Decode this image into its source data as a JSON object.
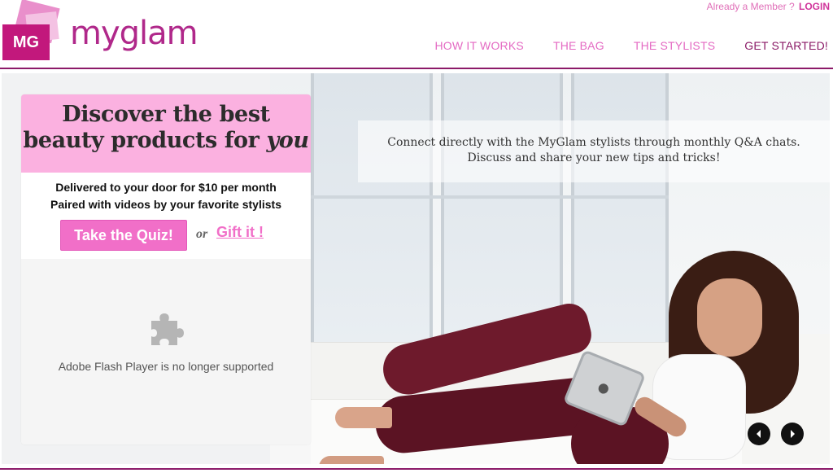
{
  "header": {
    "member_prompt": "Already a Member ?",
    "login_label": "LOGIN",
    "logo_mark": "MG",
    "logo_word": "myglam",
    "nav": [
      {
        "label": "HOW IT WORKS"
      },
      {
        "label": "THE BAG"
      },
      {
        "label": "THE STYLISTS"
      },
      {
        "label": "GET STARTED!"
      }
    ]
  },
  "promo": {
    "headline_line1": "Discover the best",
    "headline_line2_prefix": "beauty products for ",
    "headline_line2_em": "you",
    "subline1": "Delivered to your door for $10 per month",
    "subline2": "Paired with videos by your favorite stylists",
    "quiz_button": "Take the Quiz!",
    "or_text": "or",
    "gift_link": "Gift it !"
  },
  "flash": {
    "message": "Adobe Flash Player is no longer supported",
    "icon": "puzzle-piece-icon"
  },
  "hero": {
    "info_line1": "Connect directly with the MyGlam stylists through monthly Q&A chats.",
    "info_line2": "Discuss and share your new tips and tricks!"
  },
  "slider": {
    "prev_icon": "chevron-left-icon",
    "next_icon": "chevron-right-icon"
  },
  "colors": {
    "brand": "#b0288a",
    "accent": "#f16fc8",
    "card_head": "#fbb1e0",
    "rule": "#8c1a69"
  }
}
